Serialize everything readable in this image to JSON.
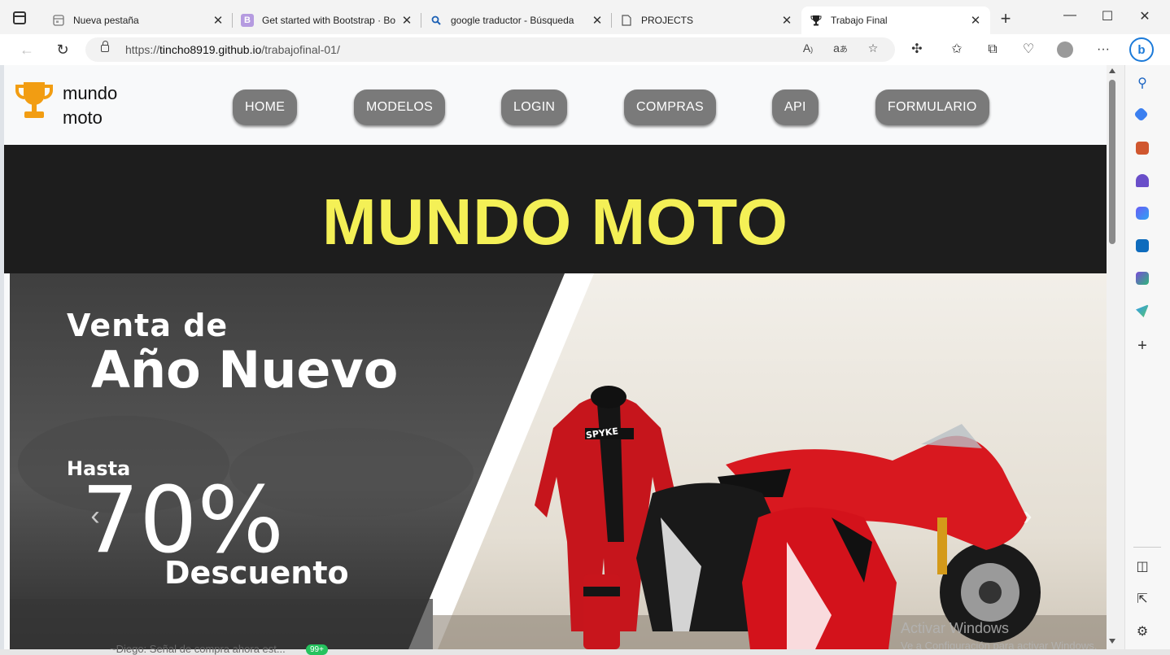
{
  "browser": {
    "tabs": [
      {
        "title": "Nueva pestaña",
        "icon": "newtab-icon"
      },
      {
        "title": "Get started with Bootstrap · Boo",
        "icon": "bootstrap-icon"
      },
      {
        "title": "google traductor - Búsqueda",
        "icon": "search-icon"
      },
      {
        "title": "PROJECTS",
        "icon": "page-icon"
      },
      {
        "title": "Trabajo Final",
        "icon": "trophy-icon"
      }
    ],
    "url_prefix": "https://",
    "url_host": "tincho8919.github.io",
    "url_path": "/trabajofinal-01/"
  },
  "site": {
    "brand_line1": "mundo",
    "brand_line2": "moto",
    "nav": [
      "HOME",
      "MODELOS",
      "LOGIN",
      "COMPRAS",
      "API",
      "FORMULARIO"
    ],
    "hero_title": "MUNDO MOTO",
    "banner": {
      "line1": "Venta de",
      "line2": "Año Nuevo",
      "line3": "Hasta",
      "line4": "70%",
      "line5": "Descuento",
      "suit_brand": "SPYKE"
    }
  },
  "os": {
    "watermark_line1": "Activar Windows",
    "watermark_line2": "Ve a Configuración para activar Windows.",
    "notification_text": "~Diego: Señal de compra ahora est...",
    "notification_badge": "99+"
  },
  "colors": {
    "hero_title": "#f4f056",
    "hero_band": "#1d1d1d",
    "nav_button": "#7a7a7a",
    "trophy": "#f29d12"
  }
}
